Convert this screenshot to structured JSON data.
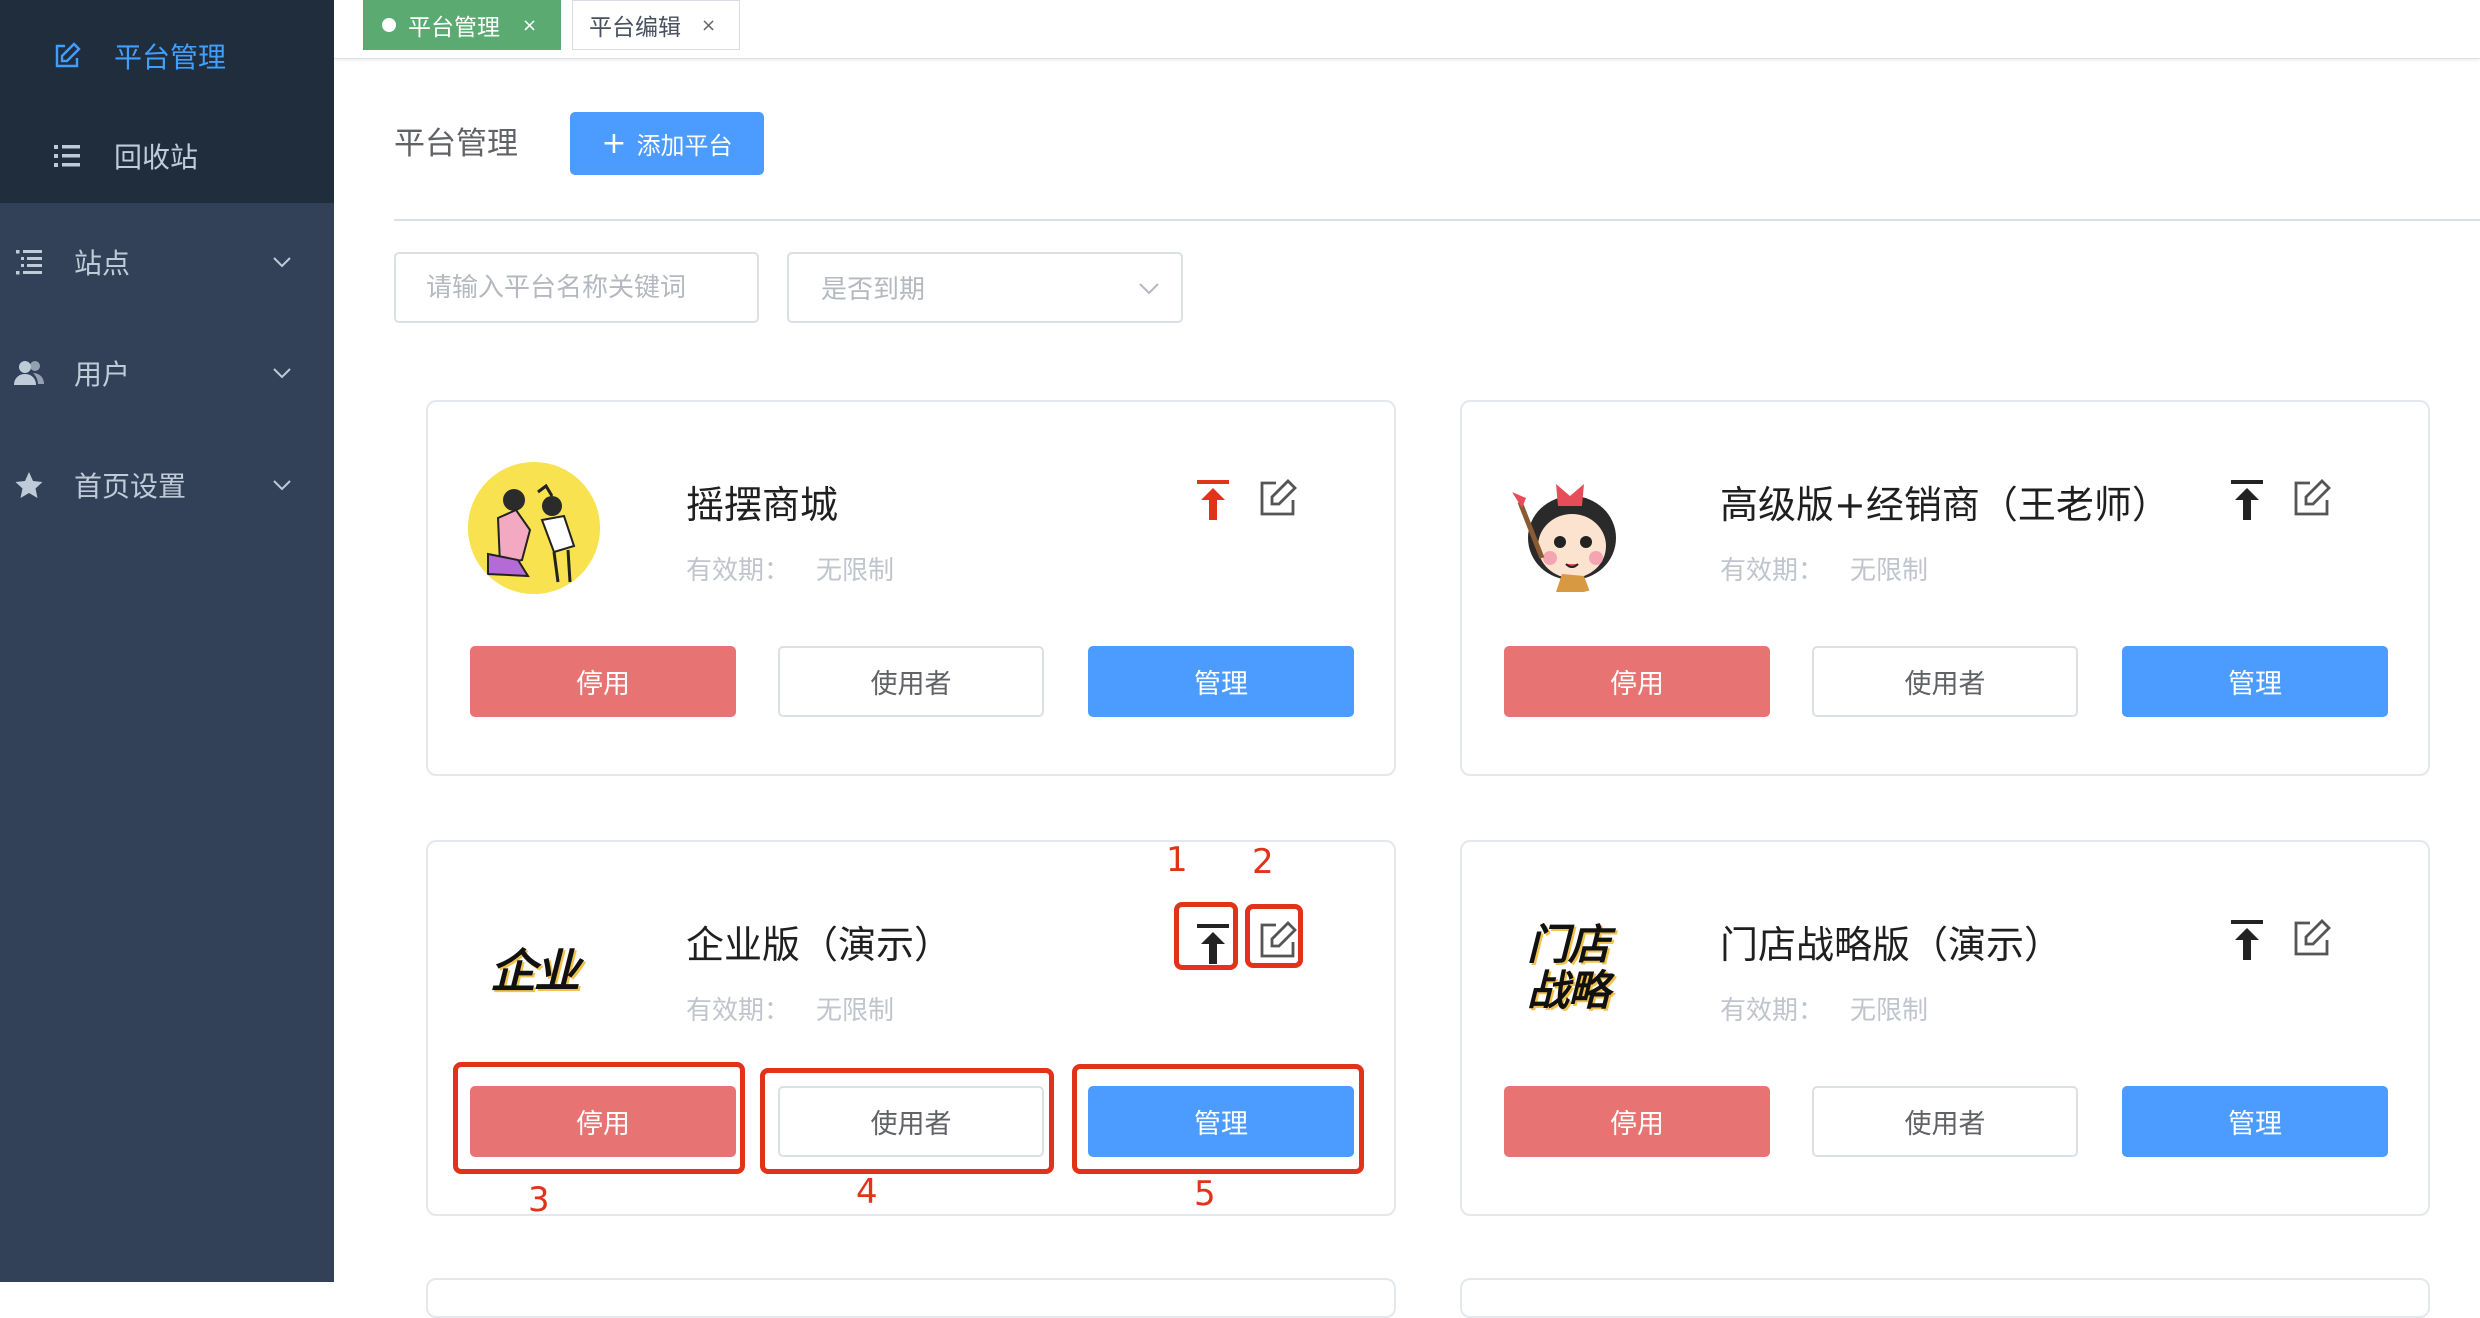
{
  "sidebar": {
    "submenu": [
      {
        "label": "平台管理",
        "icon": "edit-icon",
        "active": true
      },
      {
        "label": "回收站",
        "icon": "list-icon"
      }
    ],
    "groups": [
      {
        "label": "站点",
        "icon": "indent-list-icon"
      },
      {
        "label": "用户",
        "icon": "user-group-icon"
      },
      {
        "label": "首页设置",
        "icon": "star-icon"
      }
    ]
  },
  "tabs": [
    {
      "label": "平台管理",
      "active": true,
      "close": "×"
    },
    {
      "label": "平台编辑",
      "active": false,
      "close": "×"
    }
  ],
  "header": {
    "title": "平台管理",
    "add_button": "添加平台",
    "add_icon": "+"
  },
  "filters": {
    "search_placeholder": "请输入平台名称关键词",
    "expiry_placeholder": "是否到期"
  },
  "cards": [
    {
      "name": "摇摆商城",
      "validity_label": "有效期：",
      "validity_value": "无限制",
      "pin_color": "#e2321a"
    },
    {
      "name": "高级版+经销商（王老师）",
      "validity_label": "有效期：",
      "validity_value": "无限制",
      "pin_color": "#222222"
    },
    {
      "name": "企业版（演示）",
      "validity_label": "有效期：",
      "validity_value": "无限制",
      "logo_text": "企业",
      "pin_color": "#222222"
    },
    {
      "name": "门店战略版（演示）",
      "validity_label": "有效期：",
      "validity_value": "无限制",
      "logo_text_1": "门店",
      "logo_text_2": "战略",
      "pin_color": "#222222"
    }
  ],
  "card_buttons": {
    "disable": "停用",
    "users": "使用者",
    "manage": "管理"
  },
  "annotations": [
    "1",
    "2",
    "3",
    "4",
    "5"
  ],
  "colors": {
    "sidebar_bg": "#324157",
    "submenu_bg": "#1f2d3d",
    "active_text": "#409eff",
    "tab_active": "#5aaa71",
    "primary": "#4c9bff",
    "danger": "#e77472",
    "annotation": "#e2321a"
  }
}
